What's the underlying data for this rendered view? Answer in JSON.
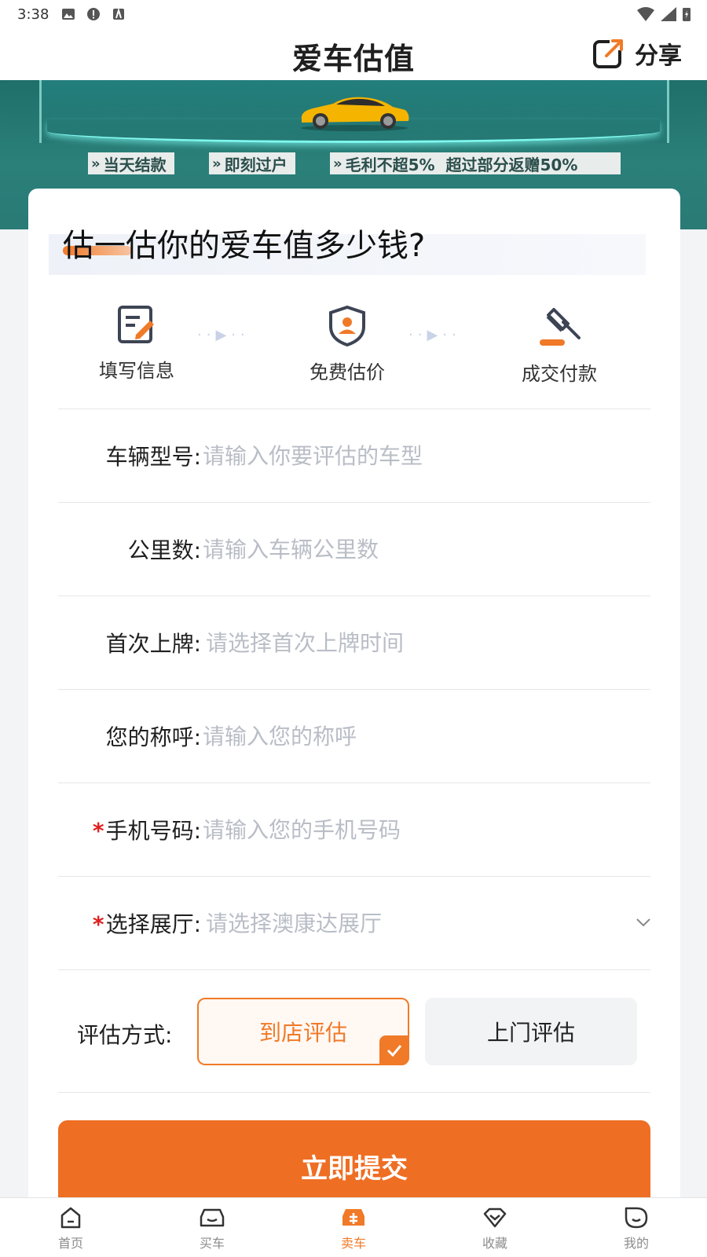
{
  "status_bar": {
    "time": "3:38"
  },
  "header": {
    "title": "爱车估值",
    "share_label": "分享"
  },
  "banner": {
    "tags": [
      "当天结款",
      "即刻过户",
      "毛利不超5%  超过部分返赠50%"
    ]
  },
  "card": {
    "title": "估一估你的爱车值多少钱?",
    "steps": [
      {
        "label": "填写信息",
        "icon": "form-edit-icon"
      },
      {
        "label": "免费估价",
        "icon": "shield-user-icon"
      },
      {
        "label": "成交付款",
        "icon": "gavel-icon"
      }
    ],
    "fields": {
      "model": {
        "label": "车辆型号:",
        "placeholder": "请输入你要评估的车型"
      },
      "mileage": {
        "label": "公里数:",
        "placeholder": "请输入车辆公里数"
      },
      "first_reg": {
        "label": "首次上牌:",
        "placeholder": "请选择首次上牌时间"
      },
      "name": {
        "label": "您的称呼:",
        "placeholder": "请输入您的称呼"
      },
      "phone": {
        "label": "手机号码:",
        "placeholder": "请输入您的手机号码",
        "required": "*"
      },
      "showroom": {
        "label": "选择展厅:",
        "placeholder": "请选择澳康达展厅",
        "required": "*"
      }
    },
    "method": {
      "label": "评估方式:",
      "options": [
        "到店评估",
        "上门评估"
      ],
      "selected": "到店评估"
    },
    "submit_label": "立即提交"
  },
  "bottom_nav": [
    {
      "label": "首页",
      "icon": "home-icon"
    },
    {
      "label": "买车",
      "icon": "buy-car-icon"
    },
    {
      "label": "卖车",
      "icon": "sell-car-icon",
      "active": true
    },
    {
      "label": "收藏",
      "icon": "favorite-icon"
    },
    {
      "label": "我的",
      "icon": "profile-icon"
    }
  ],
  "colors": {
    "accent": "#F07A28",
    "banner": "#2A7A75"
  }
}
